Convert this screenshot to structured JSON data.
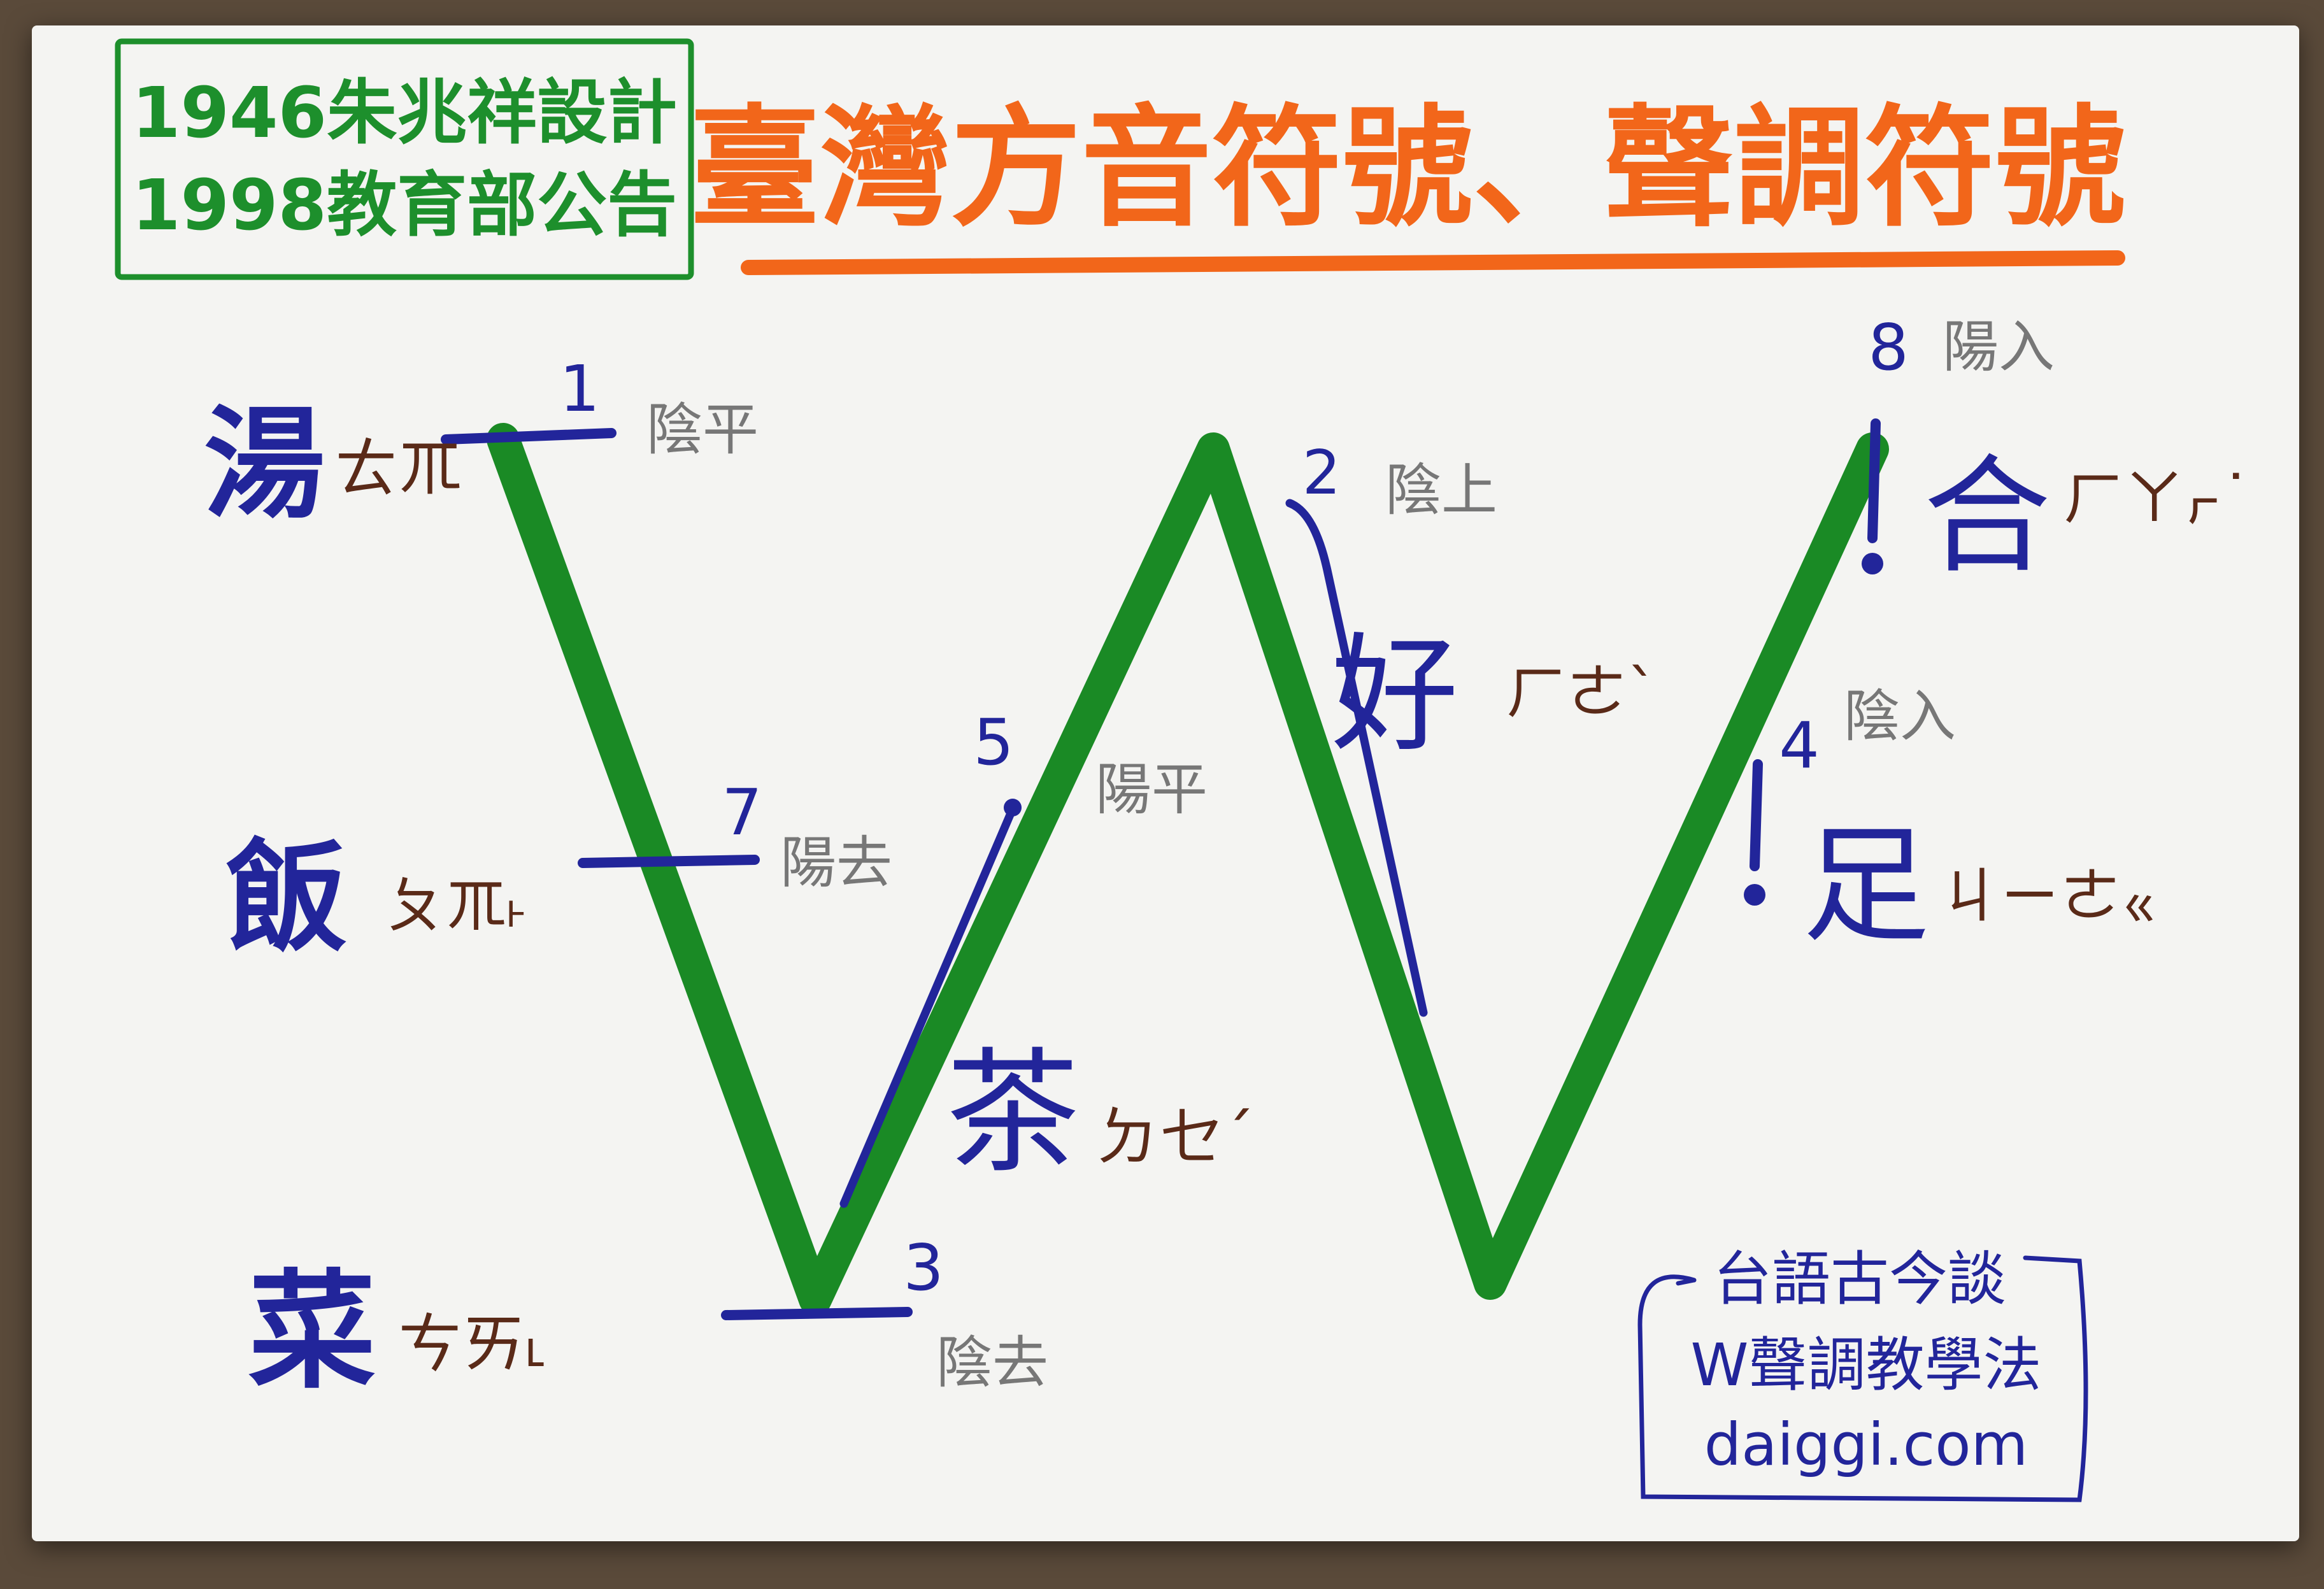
{
  "source_box": {
    "line1": "1946朱兆祥設計",
    "line2": "1998教育部公告"
  },
  "title": "臺灣方音符號、聲調符號",
  "tones": [
    {
      "number": "1",
      "name": "陰平",
      "example": "湯",
      "zhuyin": "ㄊㆭ"
    },
    {
      "number": "2",
      "name": "陰上",
      "example": "好",
      "zhuyin": "ㄏㄜˋ"
    },
    {
      "number": "3",
      "name": "陰去",
      "example": "菜",
      "zhuyin": "ㄘㄞ˪"
    },
    {
      "number": "4",
      "name": "陰入",
      "example": "足",
      "zhuyin": "ㄐㄧㄜㆻ"
    },
    {
      "number": "5",
      "name": "陽平",
      "example": "茶",
      "zhuyin": "ㄉㆤˊ"
    },
    {
      "number": "7",
      "name": "陽去",
      "example": "飯",
      "zhuyin": "ㄆㆭ˫"
    },
    {
      "number": "8",
      "name": "陽入",
      "example": "合",
      "zhuyin": "ㄏㄚㆷ˙"
    }
  ],
  "footer_box": {
    "line1": "台語古今談",
    "line2": "W聲調教學法",
    "line3": "daiggi.com"
  },
  "colors": {
    "green": "#1a8a25",
    "blue": "#22259a",
    "brown": "#5a2a18",
    "orange": "#f2661a",
    "gray": "#777777",
    "frame_green": "#1d8f2c"
  }
}
